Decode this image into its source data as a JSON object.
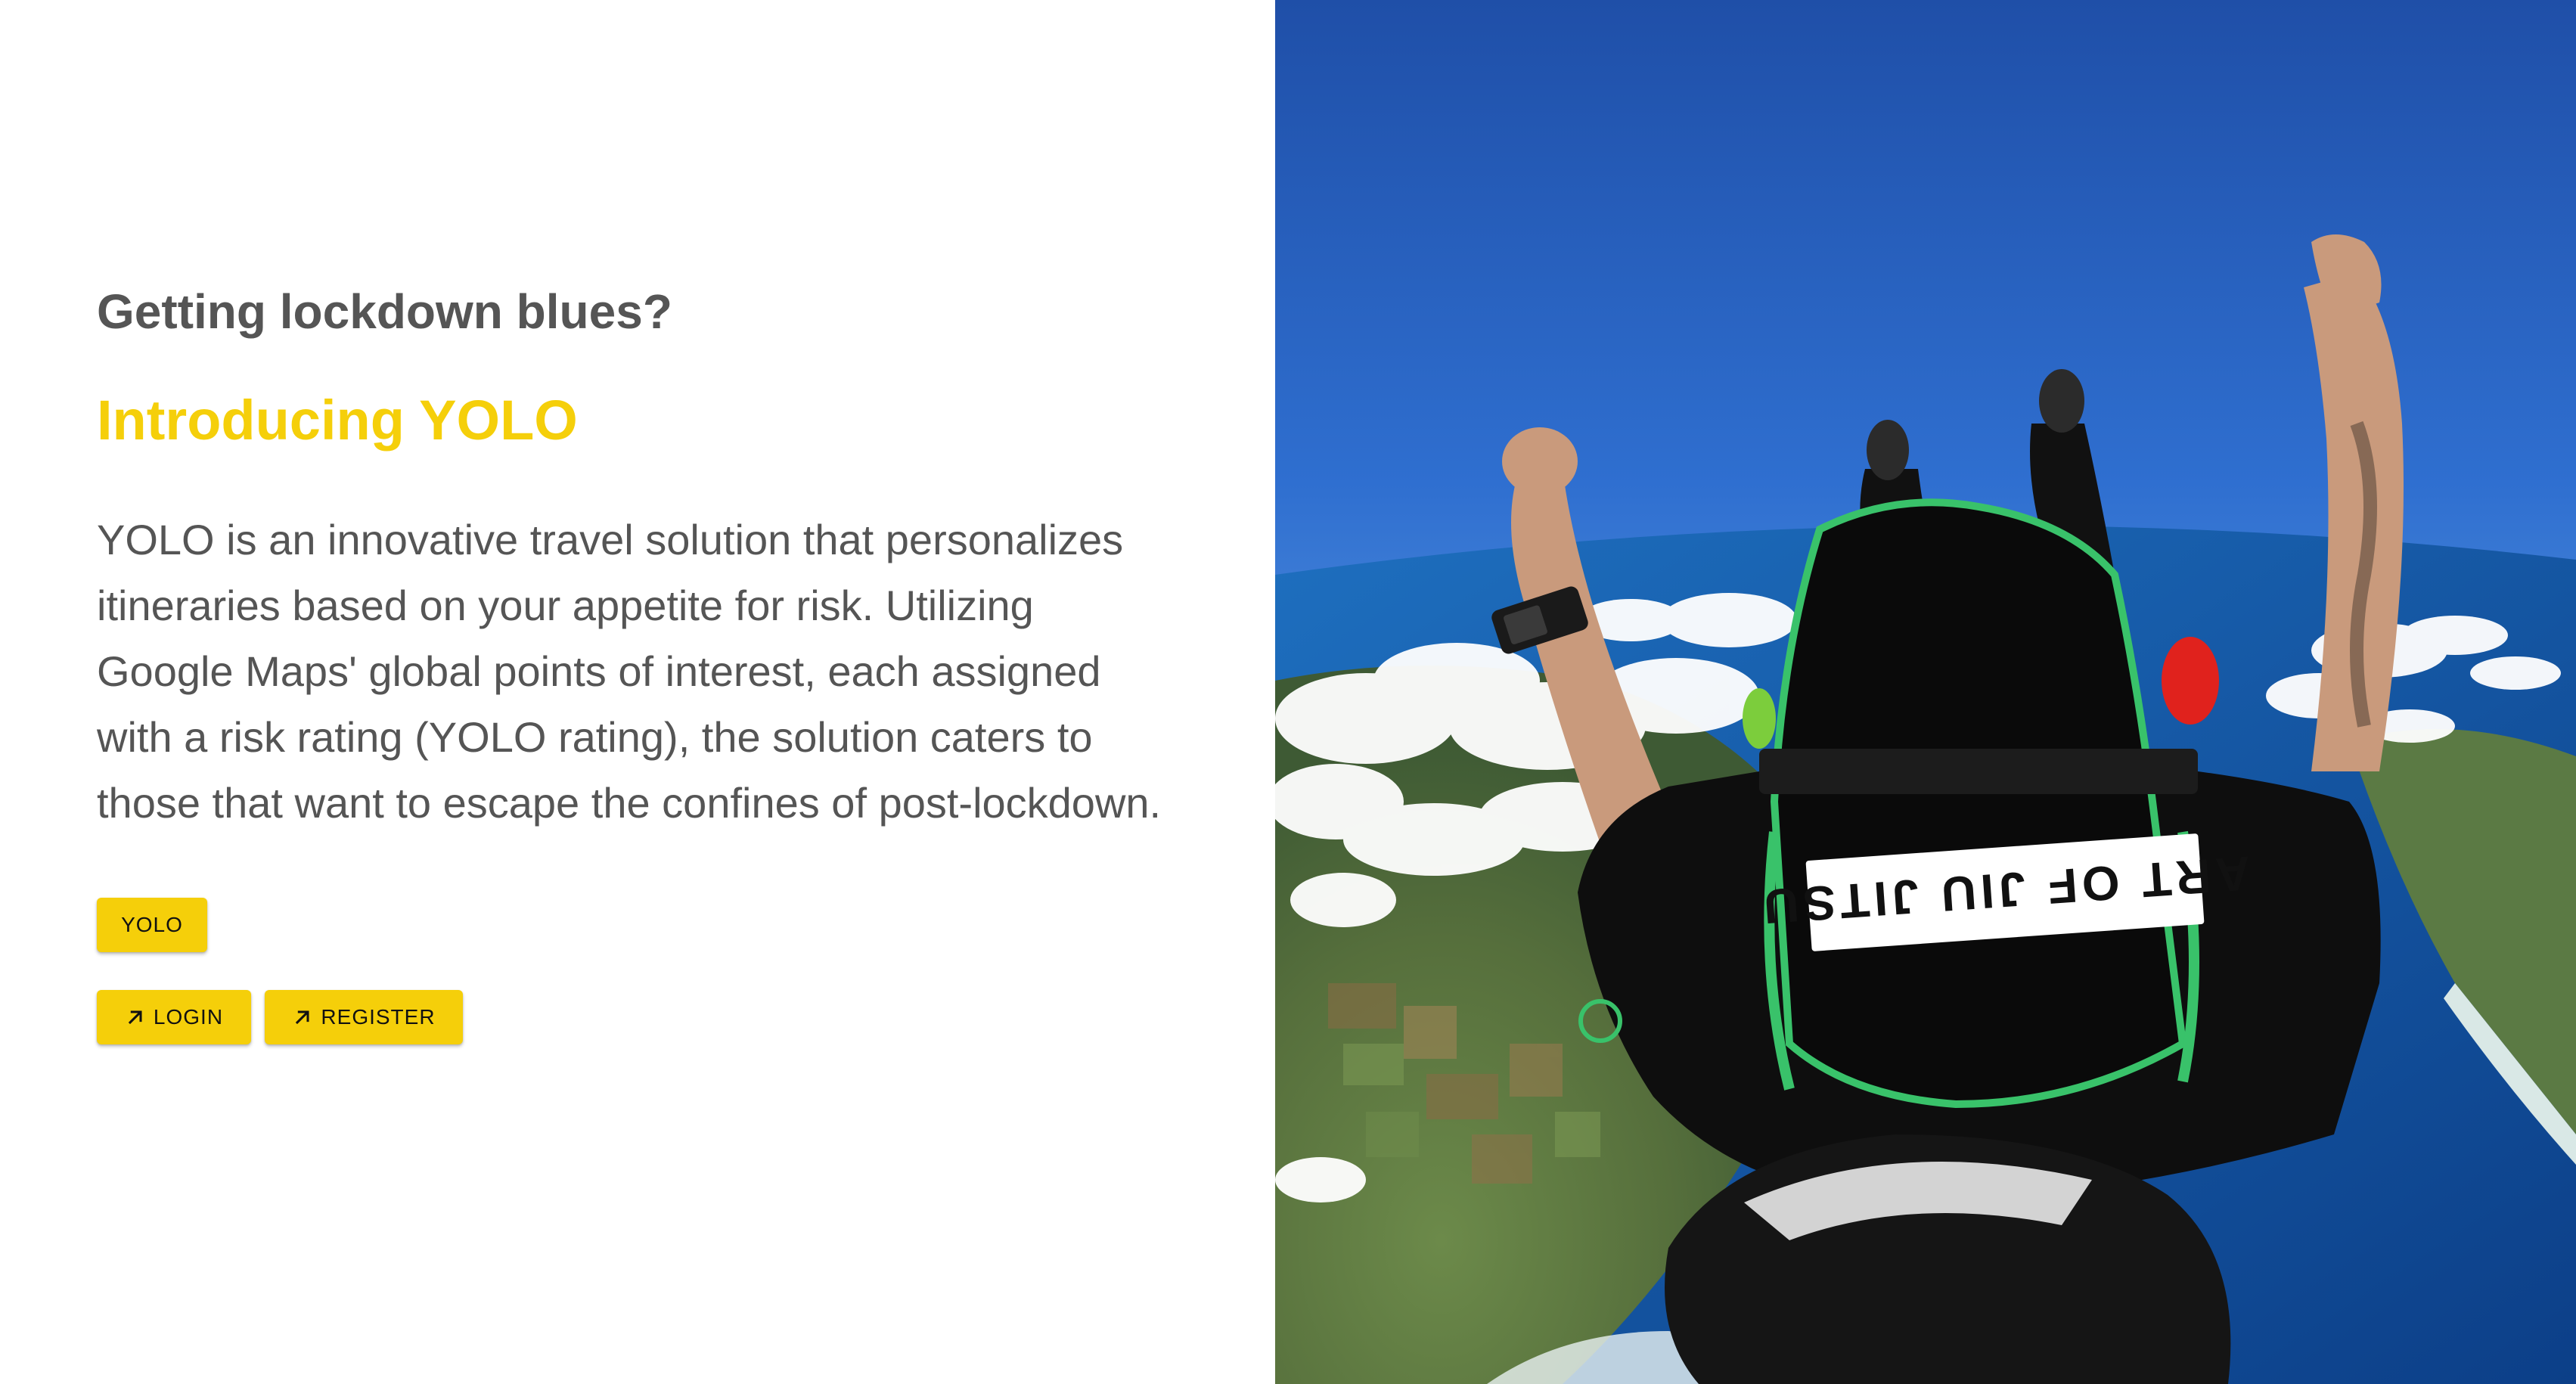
{
  "hero": {
    "subheading": "Getting lockdown blues?",
    "headline": "Introducing YOLO",
    "description": "YOLO is an innovative travel solution that personalizes itineraries based on your appetite for risk. Utilizing Google Maps' global points of interest, each assigned with a risk rating (YOLO rating), the solution caters to those that want to escape the confines of post-lockdown."
  },
  "buttons": {
    "yolo_label": "YOLO",
    "login_label": "LOGIN",
    "register_label": "REGISTER",
    "login_icon": "arrow-up-right-icon",
    "register_icon": "arrow-up-right-icon"
  },
  "photo": {
    "subject": "skydiver-photo",
    "shirt_text": "ART OF JIU JITSU"
  },
  "colors": {
    "accent": "#f5cf0a",
    "text": "#555555",
    "background": "#ffffff"
  }
}
